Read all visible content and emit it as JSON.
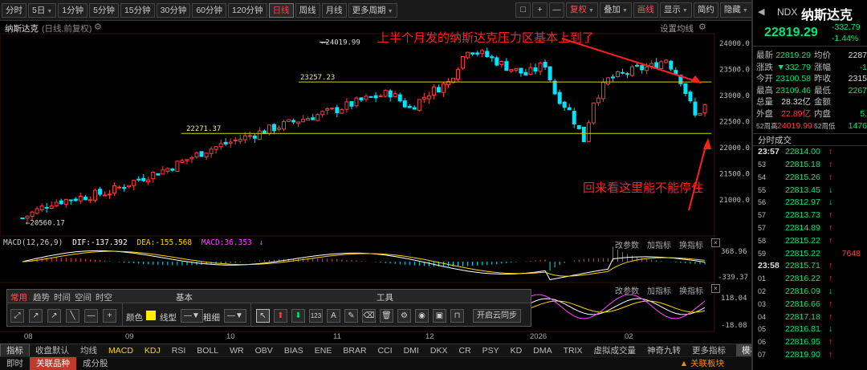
{
  "periods": [
    {
      "label": "分时",
      "active": false
    },
    {
      "label": "5日",
      "active": false,
      "caret": true
    },
    {
      "label": "1分钟",
      "active": false
    },
    {
      "label": "5分钟",
      "active": false
    },
    {
      "label": "15分钟",
      "active": false
    },
    {
      "label": "30分钟",
      "active": false
    },
    {
      "label": "60分钟",
      "active": false
    },
    {
      "label": "120分钟",
      "active": false
    },
    {
      "label": "日线",
      "active": true
    },
    {
      "label": "周线",
      "active": false
    },
    {
      "label": "月线",
      "active": false
    },
    {
      "label": "更多周期",
      "active": false,
      "caret": true
    }
  ],
  "toolbar_right": {
    "box": "□",
    "plus": "+",
    "minus": "—",
    "fuquan": "复权",
    "diejia": "叠加",
    "huaxian": "画线",
    "xianshi": "显示",
    "jianyue": "简约",
    "yincang": "隐藏"
  },
  "chart_header": {
    "name": "纳斯达克",
    "sub": "(日线,前复权)",
    "settings": "设置均线"
  },
  "price_axis": [
    "24000.0",
    "23500.0",
    "23000.0",
    "22500.0",
    "22000.0",
    "21500.0",
    "21000.0"
  ],
  "annotations": {
    "high": "24019.99",
    "level_upper": "23257.23",
    "level_lower": "22271.37",
    "low": "20560.17",
    "text_top": "上半个月发的纳斯达克压力区基本上到了",
    "text_bottom": "回来看这里能不能停住"
  },
  "macd": {
    "name": "MACD(12,26,9)",
    "dif": "DIF:-137.392",
    "dea": "DEA:-155.568",
    "macd": "MACD:36.353",
    "arrow": "↓",
    "axis_top": "368.96",
    "axis_bottom": "-339.37"
  },
  "kdj_axis": {
    "top": "118.04",
    "bottom": "-18.08"
  },
  "sub_buttons": {
    "modify": "改参数",
    "add": "加指标",
    "switch": "换指标",
    "close": "×"
  },
  "xaxis_labels": [
    "08",
    "09",
    "10",
    "11",
    "12",
    "2026",
    "02"
  ],
  "panel": {
    "tabs": [
      "常用",
      "趋势",
      "时间",
      "空间",
      "时空"
    ],
    "section_basic": "基本",
    "section_tools": "工具",
    "color_label": "颜色",
    "linetype_label": "线型",
    "width_label": "粗细",
    "cloud_sync": "开启云同步",
    "num_icon": "123"
  },
  "indicators": [
    "指标",
    "收盘默认",
    "均线",
    "MACD",
    "KDJ",
    "RSI",
    "BOLL",
    "WR",
    "OBV",
    "BIAS",
    "ENE",
    "BRAR",
    "CCI",
    "DMI",
    "DKX",
    "CR",
    "PSY",
    "KD",
    "DMA",
    "TRIX",
    "虚拟成交量",
    "神奇九转",
    "更多指标",
    "模板"
  ],
  "bottom_tabs": {
    "t1": "即时",
    "t2": "关联品种",
    "t3": "成分股",
    "orange": "▲ 关联板块"
  },
  "quote": {
    "symbol": "NDX",
    "name": "纳斯达克",
    "price": "22819.29",
    "change": "-332.79",
    "change_pct": "-1.44%",
    "rows": [
      {
        "l1": "最新",
        "v1": "22819.29",
        "c1": "g",
        "l2": "均价",
        "v2": "2287",
        "c2": "w"
      },
      {
        "l1": "涨跌",
        "v1": "▼332.79",
        "c1": "g",
        "l2": "涨幅",
        "v2": "-1",
        "c2": "g"
      },
      {
        "l1": "今开",
        "v1": "23100.58",
        "c1": "g",
        "l2": "昨收",
        "v2": "2315",
        "c2": "w"
      },
      {
        "l1": "最高",
        "v1": "23109.46",
        "c1": "g",
        "l2": "最低",
        "v2": "2267",
        "c2": "g"
      },
      {
        "l1": "总量",
        "v1": "28.32亿",
        "c1": "w",
        "l2": "金额",
        "v2": "",
        "c2": "w"
      },
      {
        "l1": "外盘",
        "v1": "22.89亿",
        "c1": "r",
        "l2": "内盘",
        "v2": "5.",
        "c2": "g"
      },
      {
        "l1": "52周高",
        "v1": "24019.99",
        "c1": "r",
        "l2": "52周低",
        "v2": "1476",
        "c2": "g"
      }
    ],
    "ticks_title": "分时成交",
    "ticks": [
      {
        "t": "23:57",
        "p": "22814.00",
        "d": "up",
        "v": "",
        "major": true
      },
      {
        "t": "53",
        "p": "22815.18",
        "d": "up",
        "v": ""
      },
      {
        "t": "54",
        "p": "22815.26",
        "d": "up",
        "v": ""
      },
      {
        "t": "55",
        "p": "22813.45",
        "d": "dn",
        "v": ""
      },
      {
        "t": "56",
        "p": "22812.97",
        "d": "dn",
        "v": ""
      },
      {
        "t": "57",
        "p": "22813.73",
        "d": "up",
        "v": ""
      },
      {
        "t": "57",
        "p": "22814.89",
        "d": "up",
        "v": ""
      },
      {
        "t": "58",
        "p": "22815.22",
        "d": "up",
        "v": ""
      },
      {
        "t": "59",
        "p": "22815.22",
        "d": "",
        "v": "7648"
      },
      {
        "t": "23:58",
        "p": "22815.71",
        "d": "up",
        "v": "",
        "major": true
      },
      {
        "t": "01",
        "p": "22816.22",
        "d": "up",
        "v": ""
      },
      {
        "t": "02",
        "p": "22816.09",
        "d": "dn",
        "v": ""
      },
      {
        "t": "03",
        "p": "22816.66",
        "d": "up",
        "v": ""
      },
      {
        "t": "04",
        "p": "22817.18",
        "d": "up",
        "v": ""
      },
      {
        "t": "05",
        "p": "22816.81",
        "d": "dn",
        "v": ""
      },
      {
        "t": "06",
        "p": "22816.95",
        "d": "up",
        "v": ""
      },
      {
        "t": "07",
        "p": "22819.90",
        "d": "up",
        "v": ""
      }
    ]
  },
  "colors": {
    "up": "#ff3b3b",
    "down": "#00e5ff",
    "level": "#d4d400",
    "annotation": "#ff1f1f",
    "dif": "#ffffff",
    "dea": "#ffd200",
    "macd": "#ff44ff"
  }
}
